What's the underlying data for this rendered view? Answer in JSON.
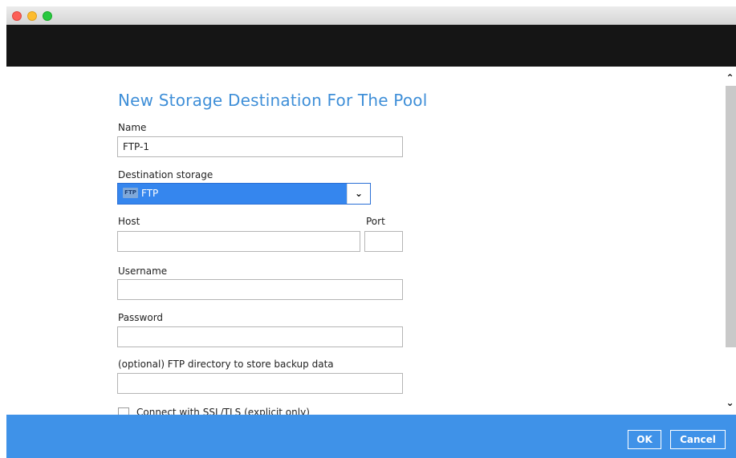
{
  "dialog": {
    "title": "New Storage Destination For The Pool"
  },
  "form": {
    "name_label": "Name",
    "name_value": "FTP-1",
    "destination_label": "Destination storage",
    "destination_badge": "FTP",
    "destination_value": "FTP",
    "host_label": "Host",
    "host_value": "",
    "port_label": "Port",
    "port_value": "",
    "username_label": "Username",
    "username_value": "",
    "password_label": "Password",
    "password_value": "",
    "directory_label": "(optional) FTP directory to store backup data",
    "directory_value": "",
    "ssl_label": "Connect with SSL/TLS (explicit only)",
    "ssl_checked": false
  },
  "footer": {
    "ok_label": "OK",
    "cancel_label": "Cancel"
  },
  "colors": {
    "title": "#3f8fd8",
    "footer": "#3f92e8",
    "selected": "#3586ee",
    "header": "#151515"
  }
}
